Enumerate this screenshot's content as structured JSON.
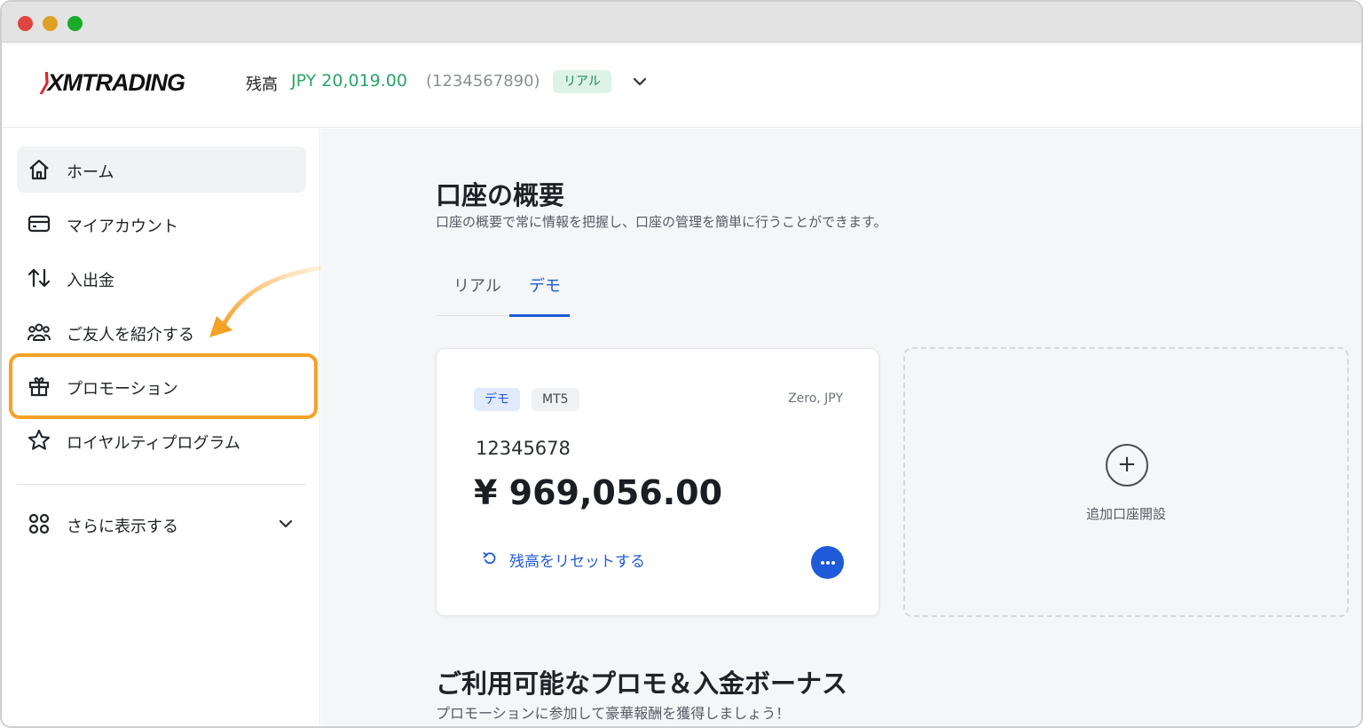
{
  "header": {
    "logo_text": "XMTRADING",
    "balance_label": "残高",
    "balance_amount": "JPY 20,019.00",
    "account_id": "(1234567890)",
    "account_type_badge": "リアル"
  },
  "sidebar": {
    "items": [
      {
        "label": "ホーム",
        "icon": "home-icon",
        "active": true
      },
      {
        "label": "マイアカウント",
        "icon": "card-icon",
        "active": false
      },
      {
        "label": "入出金",
        "icon": "transfer-arrows-icon",
        "active": false
      },
      {
        "label": "ご友人を紹介する",
        "icon": "people-icon",
        "active": false
      },
      {
        "label": "プロモーション",
        "icon": "gift-icon",
        "active": false,
        "highlighted": true
      },
      {
        "label": "ロイヤルティプログラム",
        "icon": "star-icon",
        "active": false
      }
    ],
    "more_label": "さらに表示する",
    "more_icon": "grid-icon"
  },
  "main": {
    "title": "口座の概要",
    "subtitle": "口座の概要で常に情報を把握し、口座の管理を簡単に行うことができます。",
    "tabs": [
      {
        "label": "リアル",
        "active": false
      },
      {
        "label": "デモ",
        "active": true
      }
    ],
    "account_card": {
      "tag_type": "デモ",
      "tag_platform": "MT5",
      "meta": "Zero, JPY",
      "account_number": "12345678",
      "balance": "¥ 969,056.00",
      "reset_label": "残高をリセットする"
    },
    "add_account_label": "追加口座開設",
    "promo_title": "ご利用可能なプロモ＆入金ボーナス",
    "promo_subtitle": "プロモーションに参加して豪華報酬を獲得しましょう！"
  },
  "colors": {
    "accent_blue": "#1f5bd8",
    "balance_green": "#2aa36b",
    "highlight_orange": "#f5a125",
    "brand_red": "#e1242a"
  }
}
